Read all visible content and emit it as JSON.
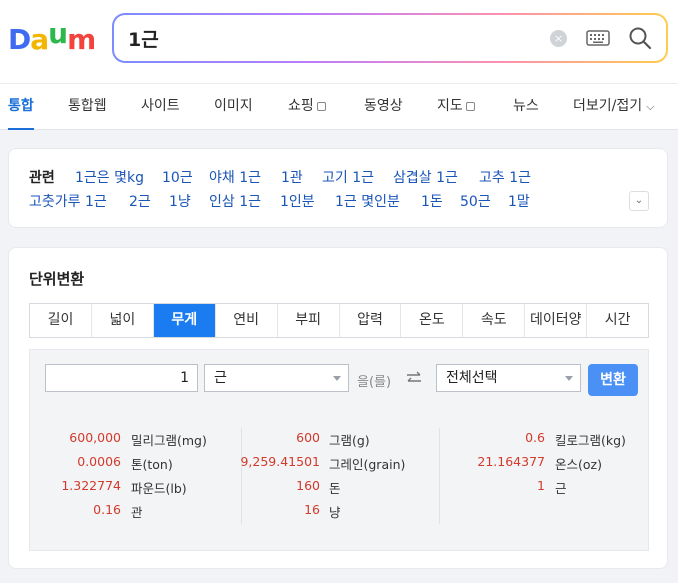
{
  "header": {
    "logo": "Daum",
    "search_value": "1근",
    "clear_icon_glyph": "×"
  },
  "tabs": [
    {
      "label": "통합",
      "active": true
    },
    {
      "label": "통합웹"
    },
    {
      "label": "사이트"
    },
    {
      "label": "이미지"
    },
    {
      "label": "쇼핑"
    },
    {
      "label": "동영상"
    },
    {
      "label": "지도"
    },
    {
      "label": "뉴스"
    },
    {
      "label": "더보기/접기"
    }
  ],
  "related": {
    "heading": "관련",
    "row1": [
      "1근은 몇kg",
      "10근",
      "야채 1근",
      "1관",
      "고기 1근",
      "삼겹살 1근",
      "고추 1근"
    ],
    "row2": [
      "고춧가루 1근",
      "2근",
      "1냥",
      "인삼 1근",
      "1인분",
      "1근 몇인분",
      "1돈",
      "50근",
      "1말"
    ],
    "more_glyph": "⌄"
  },
  "unit_converter": {
    "title": "단위변환",
    "tabs": [
      "길이",
      "넓이",
      "무게",
      "연비",
      "부피",
      "압력",
      "온도",
      "속도",
      "데이터양",
      "시간"
    ],
    "active_tab": "무게",
    "input_value": "1",
    "from_unit": "근",
    "particle": "을(를)",
    "to_unit": "전체선택",
    "convert_label": "변환",
    "results": [
      [
        {
          "value": "600,000",
          "unit": "밀리그램(mg)"
        },
        {
          "value": "0.0006",
          "unit": "톤(ton)"
        },
        {
          "value": "1.322774",
          "unit": "파운드(lb)"
        },
        {
          "value": "0.16",
          "unit": "관"
        }
      ],
      [
        {
          "value": "600",
          "unit": "그램(g)"
        },
        {
          "value": "9,259.41501",
          "unit": "그레인(grain)"
        },
        {
          "value": "160",
          "unit": "돈"
        },
        {
          "value": "16",
          "unit": "냥"
        }
      ],
      [
        {
          "value": "0.6",
          "unit": "킬로그램(kg)"
        },
        {
          "value": "21.164377",
          "unit": "온스(oz)"
        },
        {
          "value": "1",
          "unit": "근"
        }
      ]
    ]
  },
  "colors": {
    "accent": "#1a6fd9",
    "active_tab_bg": "#1a7cf0",
    "result_number": "#d33a2c",
    "link": "#1a55b8"
  }
}
